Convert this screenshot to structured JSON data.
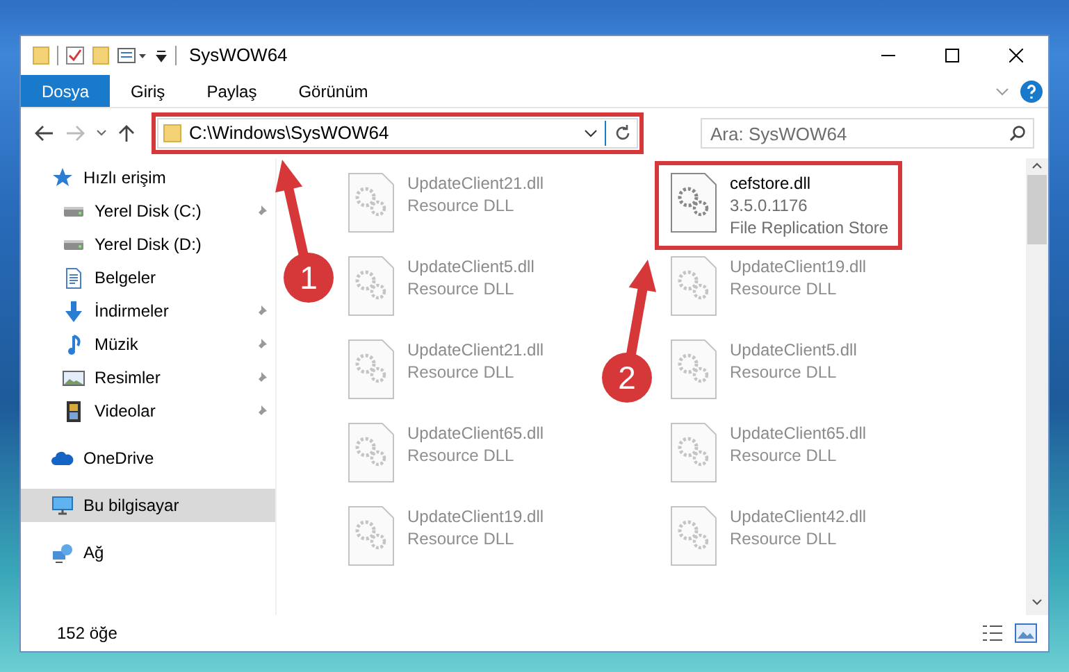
{
  "window": {
    "title": "SysWOW64"
  },
  "ribbon_tabs": [
    {
      "label": "Dosya",
      "selected": true
    },
    {
      "label": "Giriş",
      "selected": false
    },
    {
      "label": "Paylaş",
      "selected": false
    },
    {
      "label": "Görünüm",
      "selected": false
    }
  ],
  "address": {
    "path": "C:\\Windows\\SysWOW64"
  },
  "search": {
    "placeholder": "Ara: SysWOW64"
  },
  "sidebar": {
    "items": [
      {
        "label": "Hızlı erişim",
        "kind": "star",
        "selected": false,
        "children": [
          {
            "label": "Yerel Disk (C:)",
            "kind": "drive",
            "pinned": true,
            "selected": false
          },
          {
            "label": "Yerel Disk (D:)",
            "kind": "drive",
            "pinned": false,
            "selected": false
          },
          {
            "label": "Belgeler",
            "kind": "document",
            "pinned": false,
            "selected": false
          },
          {
            "label": "İndirmeler",
            "kind": "download",
            "pinned": true,
            "selected": false
          },
          {
            "label": "Müzik",
            "kind": "music",
            "pinned": true,
            "selected": false
          },
          {
            "label": "Resimler",
            "kind": "picture",
            "pinned": true,
            "selected": false
          },
          {
            "label": "Videolar",
            "kind": "video",
            "pinned": true,
            "selected": false
          }
        ]
      },
      {
        "label": "OneDrive",
        "kind": "cloud",
        "selected": false
      },
      {
        "label": "Bu bilgisayar",
        "kind": "computer",
        "selected": true
      },
      {
        "label": "Ağ",
        "kind": "network",
        "selected": false
      }
    ]
  },
  "files": [
    {
      "name": "UpdateClient21.dll",
      "details": [
        "Resource DLL"
      ],
      "blurred": true
    },
    {
      "name": "cefstore.dll",
      "details": [
        "3.5.0.1176",
        "File Replication Store"
      ],
      "blurred": false
    },
    {
      "name": "UpdateClient5.dll",
      "details": [
        "Resource DLL"
      ],
      "blurred": true
    },
    {
      "name": "UpdateClient19.dll",
      "details": [
        "Resource DLL"
      ],
      "blurred": true
    },
    {
      "name": "UpdateClient21.dll",
      "details": [
        "Resource DLL"
      ],
      "blurred": true
    },
    {
      "name": "UpdateClient5.dll",
      "details": [
        "Resource DLL"
      ],
      "blurred": true
    },
    {
      "name": "UpdateClient65.dll",
      "details": [
        "Resource DLL"
      ],
      "blurred": true
    },
    {
      "name": "UpdateClient65.dll",
      "details": [
        "Resource DLL"
      ],
      "blurred": true
    },
    {
      "name": "UpdateClient19.dll",
      "details": [
        "Resource DLL"
      ],
      "blurred": true
    },
    {
      "name": "UpdateClient42.dll",
      "details": [
        "Resource DLL"
      ],
      "blurred": true
    }
  ],
  "status_bar": {
    "count": "152 öğe"
  },
  "annotations": [
    {
      "label": "1"
    },
    {
      "label": "2"
    }
  ]
}
